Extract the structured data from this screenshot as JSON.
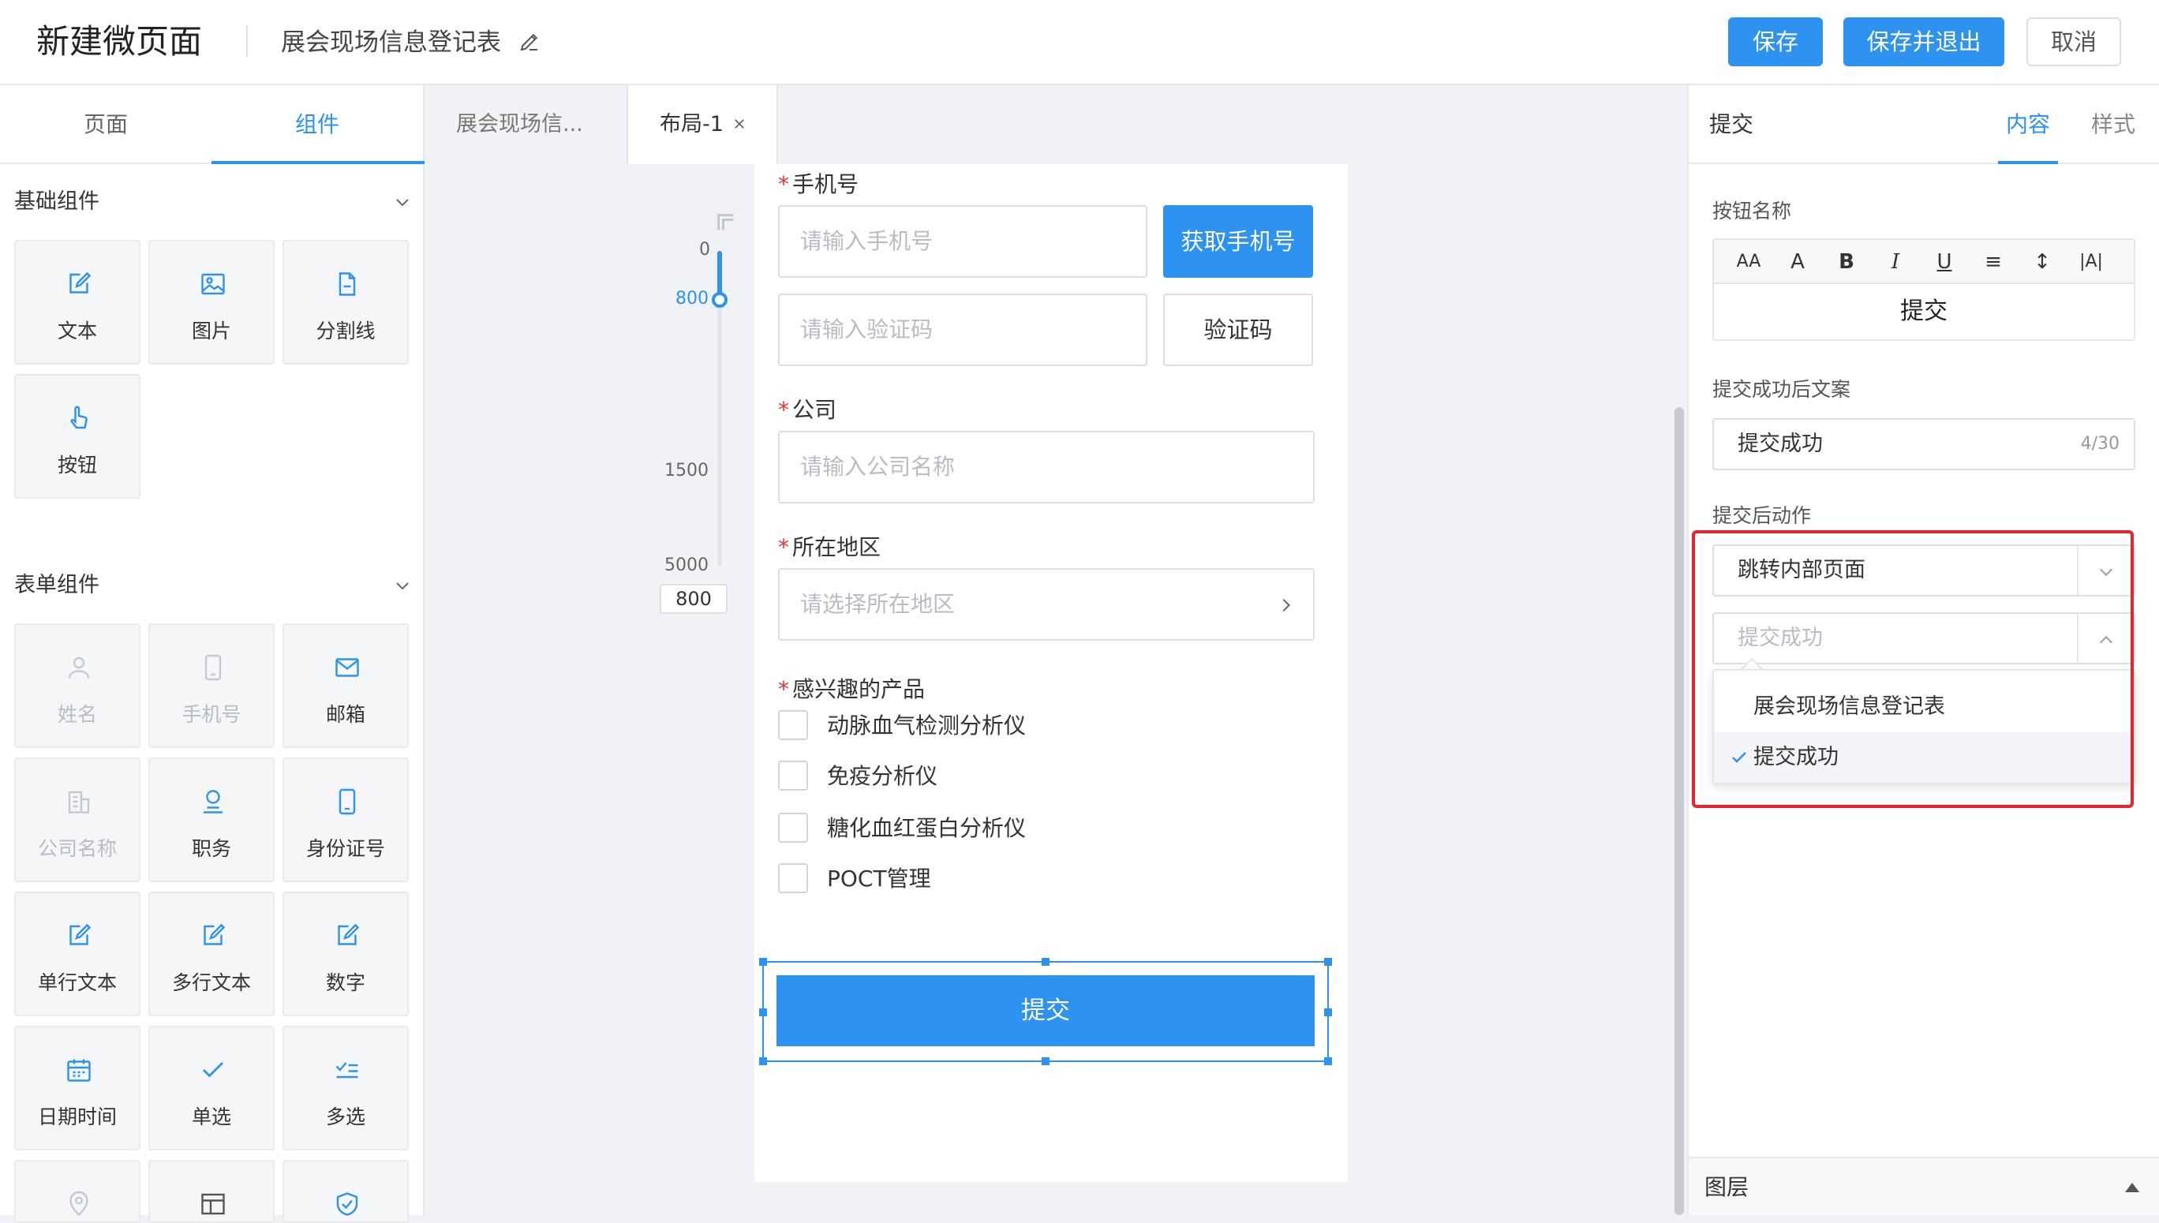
{
  "header": {
    "app_title": "新建微页面",
    "doc_title": "展会现场信息登记表",
    "save_label": "保存",
    "save_exit_label": "保存并退出",
    "cancel_label": "取消",
    "accent": "#2d92f0"
  },
  "left_panel": {
    "tabs": [
      {
        "label": "页面"
      },
      {
        "label": "组件"
      }
    ],
    "basic": {
      "title": "基础组件",
      "items": [
        {
          "label": "文本",
          "icon": "edit-icon"
        },
        {
          "label": "图片",
          "icon": "image-icon"
        },
        {
          "label": "分割线",
          "icon": "document-icon"
        },
        {
          "label": "按钮",
          "icon": "pointer-icon"
        }
      ]
    },
    "form": {
      "title": "表单组件",
      "items": [
        {
          "label": "姓名",
          "icon": "user-icon",
          "disabled": true
        },
        {
          "label": "手机号",
          "icon": "phone-icon",
          "disabled": true
        },
        {
          "label": "邮箱",
          "icon": "mail-icon"
        },
        {
          "label": "公司名称",
          "icon": "building-icon",
          "disabled": true
        },
        {
          "label": "职务",
          "icon": "badge-icon"
        },
        {
          "label": "身份证号",
          "icon": "mobile-icon"
        },
        {
          "label": "单行文本",
          "icon": "edit-icon"
        },
        {
          "label": "多行文本",
          "icon": "edit-icon"
        },
        {
          "label": "数字",
          "icon": "edit-icon"
        },
        {
          "label": "日期时间",
          "icon": "calendar-icon"
        },
        {
          "label": "单选",
          "icon": "check-icon"
        },
        {
          "label": "多选",
          "icon": "checklist-icon"
        }
      ]
    }
  },
  "center_tabs": [
    {
      "label": "展会现场信..."
    },
    {
      "label": "布局-1"
    }
  ],
  "ruler": {
    "labels": [
      "0",
      "800",
      "1500",
      "5000"
    ],
    "value": "800"
  },
  "form": {
    "phone": {
      "label": "手机号",
      "placeholder": "请输入手机号",
      "button": "获取手机号"
    },
    "code": {
      "placeholder": "请输入验证码",
      "button": "验证码"
    },
    "company": {
      "label": "公司",
      "placeholder": "请输入公司名称"
    },
    "region": {
      "label": "所在地区",
      "placeholder": "请选择所在地区"
    },
    "products": {
      "label": "感兴趣的产品",
      "options": [
        "动脉血气检测分析仪",
        "免疫分析仪",
        "糖化血红蛋白分析仪",
        "POCT管理"
      ]
    },
    "submit_label": "提交",
    "required_mark": "*"
  },
  "right_panel": {
    "title": "提交",
    "tabs": [
      {
        "label": "内容"
      },
      {
        "label": "样式"
      }
    ],
    "button_name_label": "按钮名称",
    "toolbar": [
      "AA",
      "A",
      "B",
      "I",
      "U",
      "≡",
      "↕",
      "|A|"
    ],
    "button_name_value": "提交",
    "success_text_label": "提交成功后文案",
    "success_text_value": "提交成功",
    "success_text_count": "4/30",
    "after_action_label": "提交后动作",
    "action_selected": "跳转内部页面",
    "page_placeholder": "提交成功",
    "dropdown_options": [
      "展会现场信息登记表",
      "提交成功"
    ],
    "layers_label": "图层"
  }
}
